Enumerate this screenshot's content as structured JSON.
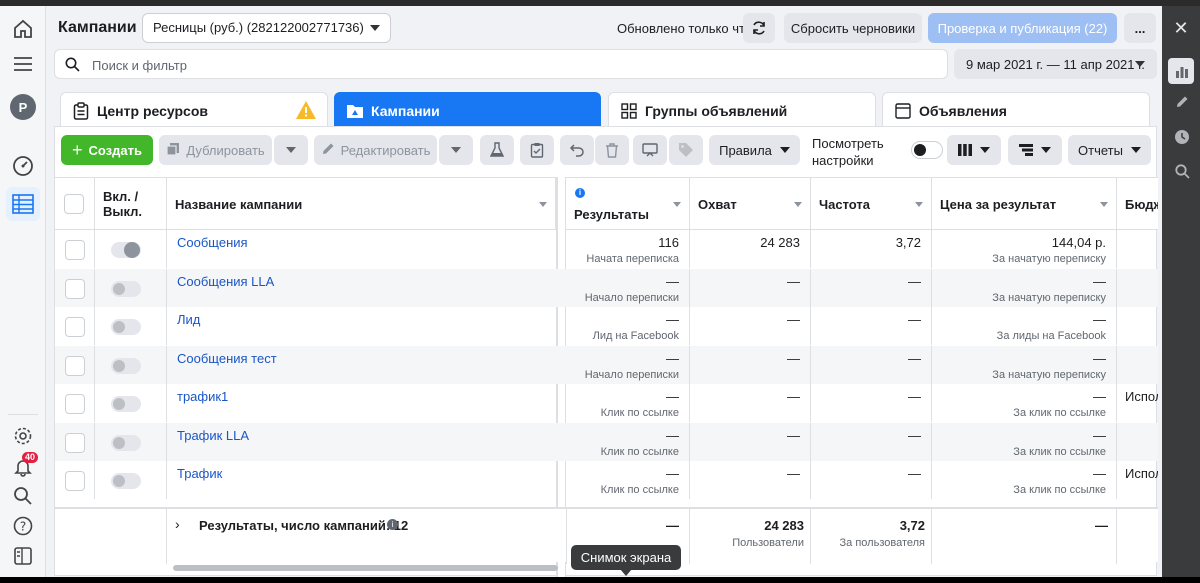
{
  "header": {
    "title": "Кампании",
    "account": "Ресницы (руб.) (282122002771736)",
    "updated": "Обновлено только что",
    "reset_drafts": "Сбросить черновики",
    "review_publish": "Проверка и публикация (22)",
    "more": "..."
  },
  "search": {
    "placeholder": "Поиск и фильтр"
  },
  "date_range": "9 мар 2021 г. — 11 апр 2021 г.",
  "tabs": [
    {
      "label": "Центр ресурсов"
    },
    {
      "label": "Кампании"
    },
    {
      "label": "Группы объявлений"
    },
    {
      "label": "Объявления"
    }
  ],
  "toolbar": {
    "create": "Создать",
    "duplicate": "Дублировать",
    "edit": "Редактировать",
    "rules": "Правила",
    "view_settings": "Посмотреть настройки",
    "reports": "Отчеты"
  },
  "columns": {
    "toggle": "Вкл. / Выкл.",
    "name": "Название кампании",
    "results": "Результаты",
    "reach": "Охват",
    "frequency": "Частота",
    "cost": "Цена за результат",
    "budget": "Бюдж"
  },
  "rows": [
    {
      "name": "Сообщения",
      "on": true,
      "results": "116",
      "results_sub": "Начата переписка",
      "reach": "24 283",
      "frequency": "3,72",
      "cost": "144,04 р.",
      "cost_sub": "За начатую переписку",
      "budget": ""
    },
    {
      "name": "Сообщения LLA",
      "on": false,
      "results": "—",
      "results_sub": "Начало переписки",
      "reach": "—",
      "frequency": "—",
      "cost": "—",
      "cost_sub": "За начатую переписку",
      "budget": ""
    },
    {
      "name": "Лид",
      "on": false,
      "results": "—",
      "results_sub": "Лид на Facebook",
      "reach": "—",
      "frequency": "—",
      "cost": "—",
      "cost_sub": "За лиды на Facebook",
      "budget": ""
    },
    {
      "name": "Сообщения тест",
      "on": false,
      "results": "—",
      "results_sub": "Начало переписки",
      "reach": "—",
      "frequency": "—",
      "cost": "—",
      "cost_sub": "За начатую переписку",
      "budget": ""
    },
    {
      "name": "трафик1",
      "on": false,
      "results": "—",
      "results_sub": "Клик по ссылке",
      "reach": "—",
      "frequency": "—",
      "cost": "—",
      "cost_sub": "За клик по ссылке",
      "budget": "Испол"
    },
    {
      "name": "Трафик LLA",
      "on": false,
      "results": "—",
      "results_sub": "Клик по ссылке",
      "reach": "—",
      "frequency": "—",
      "cost": "—",
      "cost_sub": "За клик по ссылке",
      "budget": ""
    },
    {
      "name": "Трафик",
      "on": false,
      "results": "—",
      "results_sub": "Клик по ссылке",
      "reach": "—",
      "frequency": "—",
      "cost": "—",
      "cost_sub": "За клик по ссылке",
      "budget": "Испол"
    }
  ],
  "footer": {
    "label": "Результаты, число кампаний: 12",
    "results": "—",
    "reach": "24 283",
    "reach_sub": "Пользователи",
    "frequency": "3,72",
    "frequency_sub": "За пользователя",
    "cost": "—"
  },
  "notifications_count": "40",
  "avatar_letter": "P",
  "tooltip": "Снимок экрана",
  "colors": {
    "create": "#42b72a",
    "accent": "#1877f2",
    "link": "#1a56c6",
    "publish": "#9dbff3"
  }
}
